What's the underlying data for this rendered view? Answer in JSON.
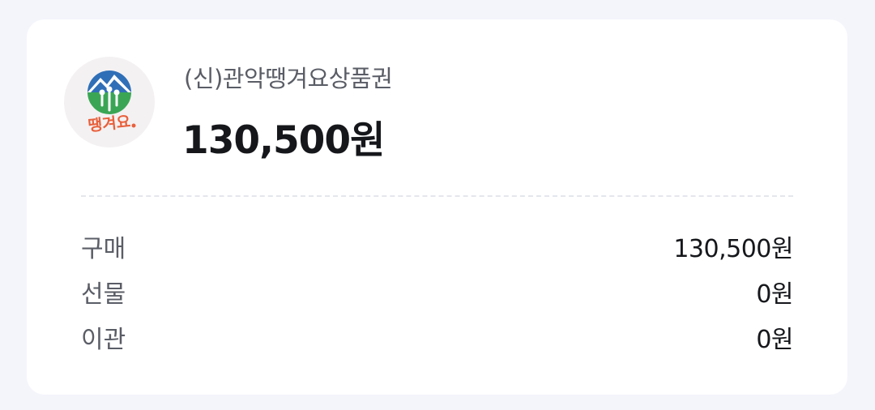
{
  "product": {
    "name": "(신)관악땡겨요상품권",
    "balance": "130,500원",
    "logo_text": "땡겨요"
  },
  "breakdown": [
    {
      "label": "구매",
      "value": "130,500원"
    },
    {
      "label": "선물",
      "value": "0원"
    },
    {
      "label": "이관",
      "value": "0원"
    }
  ],
  "colors": {
    "background": "#f4f5fb",
    "card": "#ffffff",
    "logo_bg": "#f4f1f2",
    "logo_sky": "#2f6fb7",
    "logo_leaf": "#3aa655",
    "logo_text": "#e8603c",
    "label_text": "#5a5d66",
    "value_text": "#16171b"
  }
}
